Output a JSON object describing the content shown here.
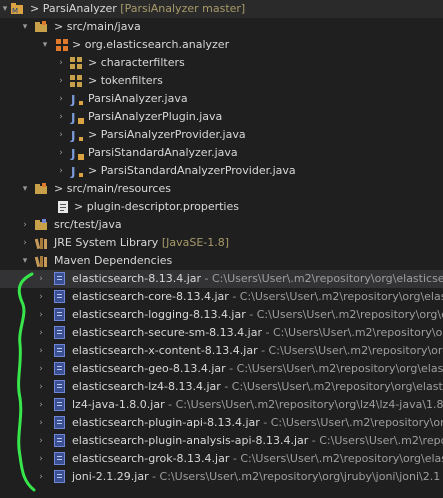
{
  "project": {
    "name": "ParsiAnalyzer",
    "branch": "[ParsiAnalyzer master]"
  },
  "tree": {
    "src_main_java": "src/main/java",
    "package": "org.elasticsearch.analyzer",
    "characterfilters": "characterfilters",
    "tokenfilters": "tokenfilters",
    "file1": "ParsiAnalyzer.java",
    "file2": "ParsiAnalyzerPlugin.java",
    "file3": "ParsiAnalyzerProvider.java",
    "file4": "ParsiStandardAnalyzer.java",
    "file5": "ParsiStandardAnalyzerProvider.java",
    "src_main_resources": "src/main/resources",
    "plugin_descriptor": "plugin-descriptor.properties",
    "src_test_java": "src/test/java",
    "jre_label": "JRE System Library",
    "jre_version": "[JavaSE-1.8]",
    "maven": "Maven Dependencies",
    "prefix_gt": ">"
  },
  "jars": [
    {
      "name": "elasticsearch-8.13.4.jar",
      "path": " - C:\\Users\\User\\.m2\\repository\\org\\elasticsea"
    },
    {
      "name": "elasticsearch-core-8.13.4.jar",
      "path": " - C:\\Users\\User\\.m2\\repository\\org\\elast"
    },
    {
      "name": "elasticsearch-logging-8.13.4.jar",
      "path": " - C:\\Users\\User\\.m2\\repository\\org\\e"
    },
    {
      "name": "elasticsearch-secure-sm-8.13.4.jar",
      "path": " - C:\\Users\\User\\.m2\\repository\\org"
    },
    {
      "name": "elasticsearch-x-content-8.13.4.jar",
      "path": " - C:\\Users\\User\\.m2\\repository\\org\\"
    },
    {
      "name": "elasticsearch-geo-8.13.4.jar",
      "path": " - C:\\Users\\User\\.m2\\repository\\org\\elast"
    },
    {
      "name": "elasticsearch-lz4-8.13.4.jar",
      "path": " - C:\\Users\\User\\.m2\\repository\\org\\elastic"
    },
    {
      "name": "lz4-java-1.8.0.jar",
      "path": " - C:\\Users\\User\\.m2\\repository\\org\\lz4\\lz4-java\\1.8."
    },
    {
      "name": "elasticsearch-plugin-api-8.13.4.jar",
      "path": " - C:\\Users\\User\\.m2\\repository\\org"
    },
    {
      "name": "elasticsearch-plugin-analysis-api-8.13.4.jar",
      "path": " - C:\\Users\\User\\.m2\\repo"
    },
    {
      "name": "elasticsearch-grok-8.13.4.jar",
      "path": " - C:\\Users\\User\\.m2\\repository\\org\\elas"
    },
    {
      "name": "joni-2.1.29.jar",
      "path": " - C:\\Users\\User\\.m2\\repository\\org\\jruby\\joni\\joni\\2.1"
    }
  ]
}
